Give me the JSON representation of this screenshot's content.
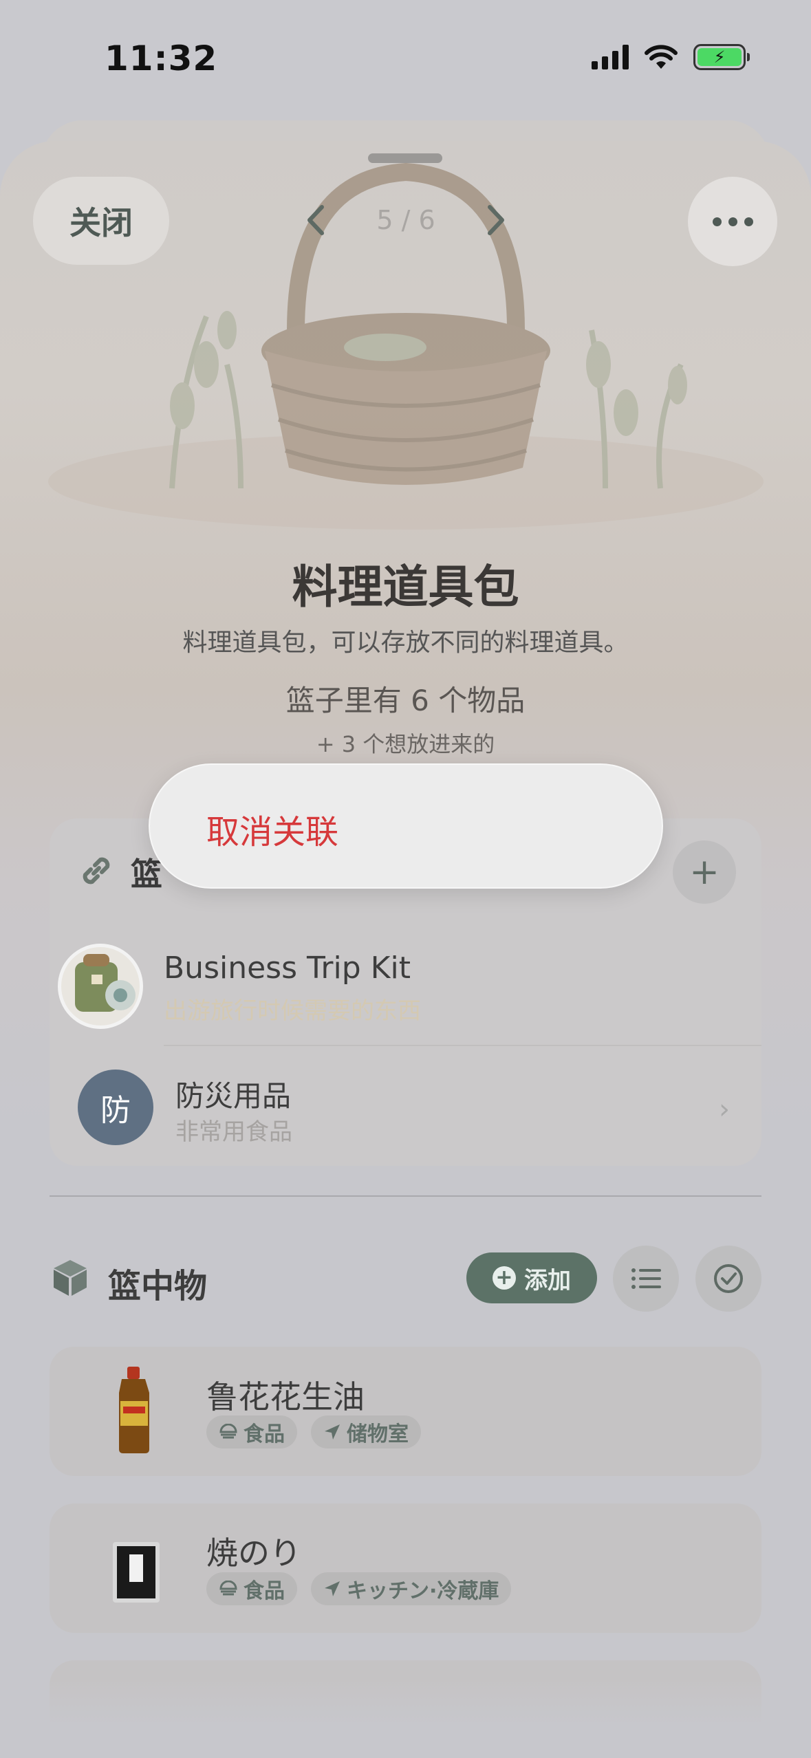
{
  "status_bar": {
    "time": "11:32"
  },
  "header": {
    "close_label": "关闭",
    "pager_text": "5 / 6"
  },
  "basket": {
    "title": "料理道具包",
    "description": "料理道具包，可以存放不同的料理道具。",
    "item_count_text": "篮子里有 6 个物品",
    "wanted_text": "+ 3 个想放进来的"
  },
  "context_menu": {
    "action_label": "取消关联"
  },
  "related": {
    "title_visible": "篮",
    "items": [
      {
        "name": "Business Trip Kit",
        "subtitle": "出游旅行时候需要的东西"
      },
      {
        "name": "防災用品",
        "subtitle": "非常用食品",
        "avatar_letter": "防"
      }
    ]
  },
  "items_section": {
    "title": "篮中物",
    "add_label": "添加",
    "items": [
      {
        "name": "鲁花花生油",
        "tags": [
          {
            "icon": "food-icon",
            "label": "食品"
          },
          {
            "icon": "location-arrow-icon",
            "label": "储物室"
          }
        ]
      },
      {
        "name": "焼のり",
        "tags": [
          {
            "icon": "food-icon",
            "label": "食品"
          },
          {
            "icon": "location-arrow-icon",
            "label": "キッチン·冷蔵庫"
          }
        ]
      }
    ]
  },
  "colors": {
    "accent_green": "#5c7267",
    "destructive_red": "#d6393b",
    "avatar_blue": "#5f7083"
  }
}
